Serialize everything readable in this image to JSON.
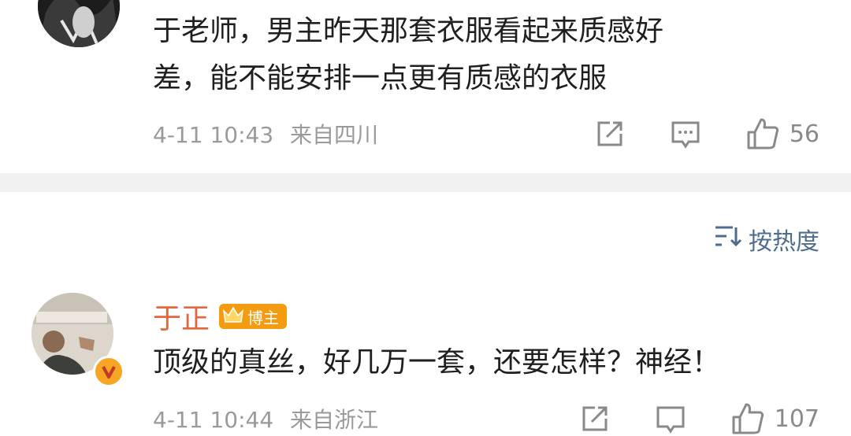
{
  "comment1": {
    "text_line1": "于老师，男主昨天那套衣服看起来质感好",
    "text_line2": "差，能不能安排一点更有质感的衣服",
    "time": "4-11 10:43",
    "location": "来自四川",
    "like_count": "56"
  },
  "sort": {
    "label": "按热度"
  },
  "comment2": {
    "author": "于正",
    "badge": "博主",
    "text": "顶级的真丝，好几万一套，还要怎样？神经！",
    "time": "4-11 10:44",
    "location": "来自浙江",
    "like_count": "107"
  },
  "icons": {
    "share": "share-icon",
    "reply": "comment-icon",
    "like": "thumbs-up-icon",
    "sort": "sort-icon",
    "verified": "verified-v-icon",
    "crown": "crown-icon"
  },
  "colors": {
    "name": "#e4663d",
    "link": "#4d6c8f",
    "meta": "#9a9a9a",
    "badge": "#f39c12"
  }
}
